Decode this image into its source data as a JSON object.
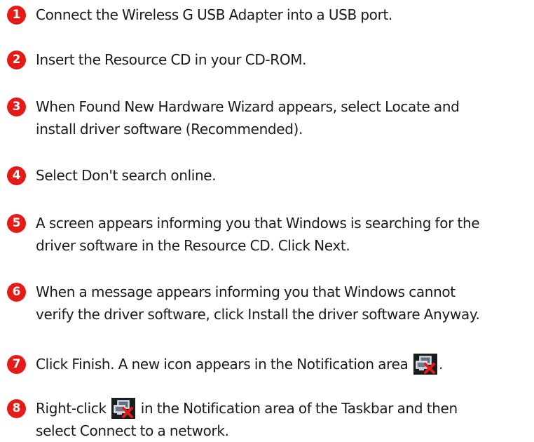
{
  "steps": [
    {
      "number": "1",
      "text": "Connect the Wireless G USB Adapter into a USB port."
    },
    {
      "number": "2",
      "text": "Insert the Resource CD in your CD-ROM."
    },
    {
      "number": "3",
      "line1": "When Found New Hardware Wizard appears, select Locate and",
      "line2": "install driver software (Recommended)."
    },
    {
      "number": "4",
      "text": "Select Don't search online."
    },
    {
      "number": "5",
      "line1": "A screen appears informing you that Windows is searching for the",
      "line2": "driver software in the Resource CD. Click Next."
    },
    {
      "number": "6",
      "line1": "When a message appears informing you that Windows cannot",
      "line2": "verify the driver software, click Install the driver software Anyway."
    },
    {
      "number": "7",
      "text_before": "Click Finish. A new icon appears in the Notification area",
      "text_after": "."
    },
    {
      "number": "8",
      "text_before": "Right-click",
      "text_after": "in the Notification area of the Taskbar and then",
      "line2": "select Connect to a network."
    }
  ],
  "icons": {
    "network_disconnected": "network-disconnected-icon",
    "badge_color": "#e41b17"
  }
}
